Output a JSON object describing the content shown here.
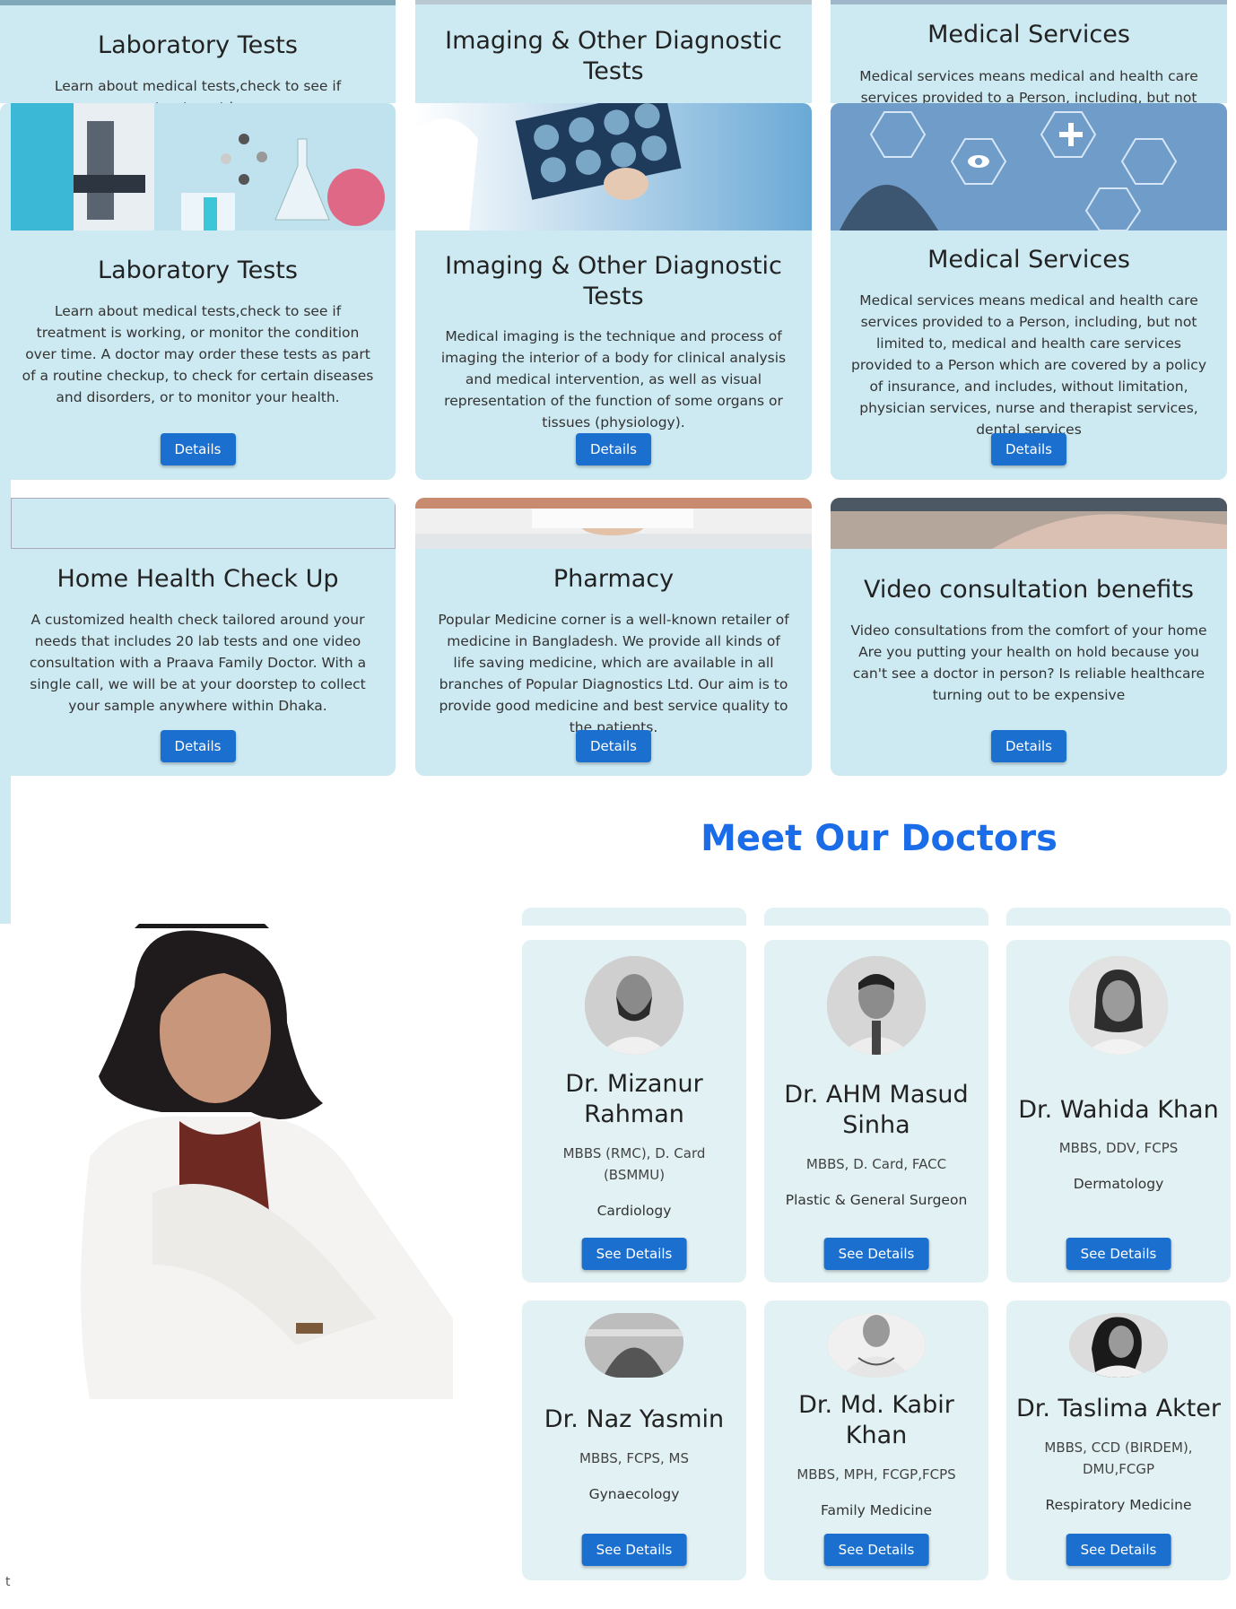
{
  "services_top_strip": [
    {
      "title": "Laboratory Tests",
      "text": "Learn about medical tests,check to see if treatment is"
    },
    {
      "title": "Imaging & Other Diagnostic Tests",
      "text": ""
    },
    {
      "title": "Medical Services",
      "text": "Medical services means medical and health care services provided to a Person, including, but not limited to,"
    }
  ],
  "services": [
    {
      "title": "Laboratory Tests",
      "text": "Learn about medical tests,check to see if treatment is working, or monitor the condition over time. A doctor may order these tests as part of a routine checkup, to check for certain diseases and disorders, or to monitor your health.",
      "button": "Details",
      "image": "laboratory-image"
    },
    {
      "title": "Imaging & Other Diagnostic Tests",
      "text": "Medical imaging is the technique and process of imaging the interior of a body for clinical analysis and medical intervention, as well as visual representation of the function of some organs or tissues (physiology).",
      "button": "Details",
      "image": "xray-image"
    },
    {
      "title": "Medical Services",
      "text": "Medical services means medical and health care services provided to a Person, including, but not limited to, medical and health care services provided to a Person which are covered by a policy of insurance, and includes, without limitation, physician services, nurse and therapist services, dental services",
      "button": "Details",
      "image": "medical-icons-image"
    },
    {
      "title": "Home Health Check Up",
      "text": "A customized health check tailored around your needs that includes 20 lab tests and one video consultation with a Praava Family Doctor. With a single call, we will be at your doorstep to collect your sample anywhere within Dhaka.",
      "button": "Details",
      "image": "broken-image"
    },
    {
      "title": "Pharmacy",
      "text": "Popular Medicine corner is a well-known retailer of medicine in Bangladesh. We provide all kinds of life saving medicine, which are available in all branches of Popular Diagnostics Ltd. Our aim is to provide good medicine and best service quality to the patients.",
      "button": "Details",
      "image": "pharmacy-image"
    },
    {
      "title": "Video consultation benefits",
      "text": "Video consultations from the comfort of your home Are you putting your health on hold because you can't see a doctor in person? Is reliable healthcare turning out to be expensive",
      "button": "Details",
      "image": "video-consult-image"
    }
  ],
  "doctors_section": {
    "title": "Meet Our Doctors",
    "doctors": [
      {
        "name": "Dr. Mizanur Rahman",
        "degree": "MBBS (RMC), D. Card (BSMMU)",
        "specialty": "Cardiology",
        "button": "See Details"
      },
      {
        "name": "Dr. AHM Masud Sinha",
        "degree": "MBBS, D. Card, FACC",
        "specialty": "Plastic & General Surgeon",
        "button": "See Details"
      },
      {
        "name": "Dr. Wahida Khan",
        "degree": "MBBS, DDV, FCPS",
        "specialty": "Dermatology",
        "button": "See Details"
      },
      {
        "name": "Dr. Naz Yasmin",
        "degree": "MBBS, FCPS, MS",
        "specialty": "Gynaecology",
        "button": "See Details"
      },
      {
        "name": "Dr. Md. Kabir Khan",
        "degree": "MBBS, MPH, FCGP,FCPS",
        "specialty": "Family Medicine",
        "button": "See Details"
      },
      {
        "name": "Dr. Taslima Akter",
        "degree": "MBBS, CCD (BIRDEM), DMU,FCGP",
        "specialty": "Respiratory Medicine",
        "button": "See Details"
      }
    ]
  },
  "footer_fragment": "t",
  "colors": {
    "card_bg": "#cdeaf2",
    "doc_card_bg": "#e2f1f3",
    "button": "#1b6fcf",
    "heading_blue": "#1a6ce8"
  }
}
